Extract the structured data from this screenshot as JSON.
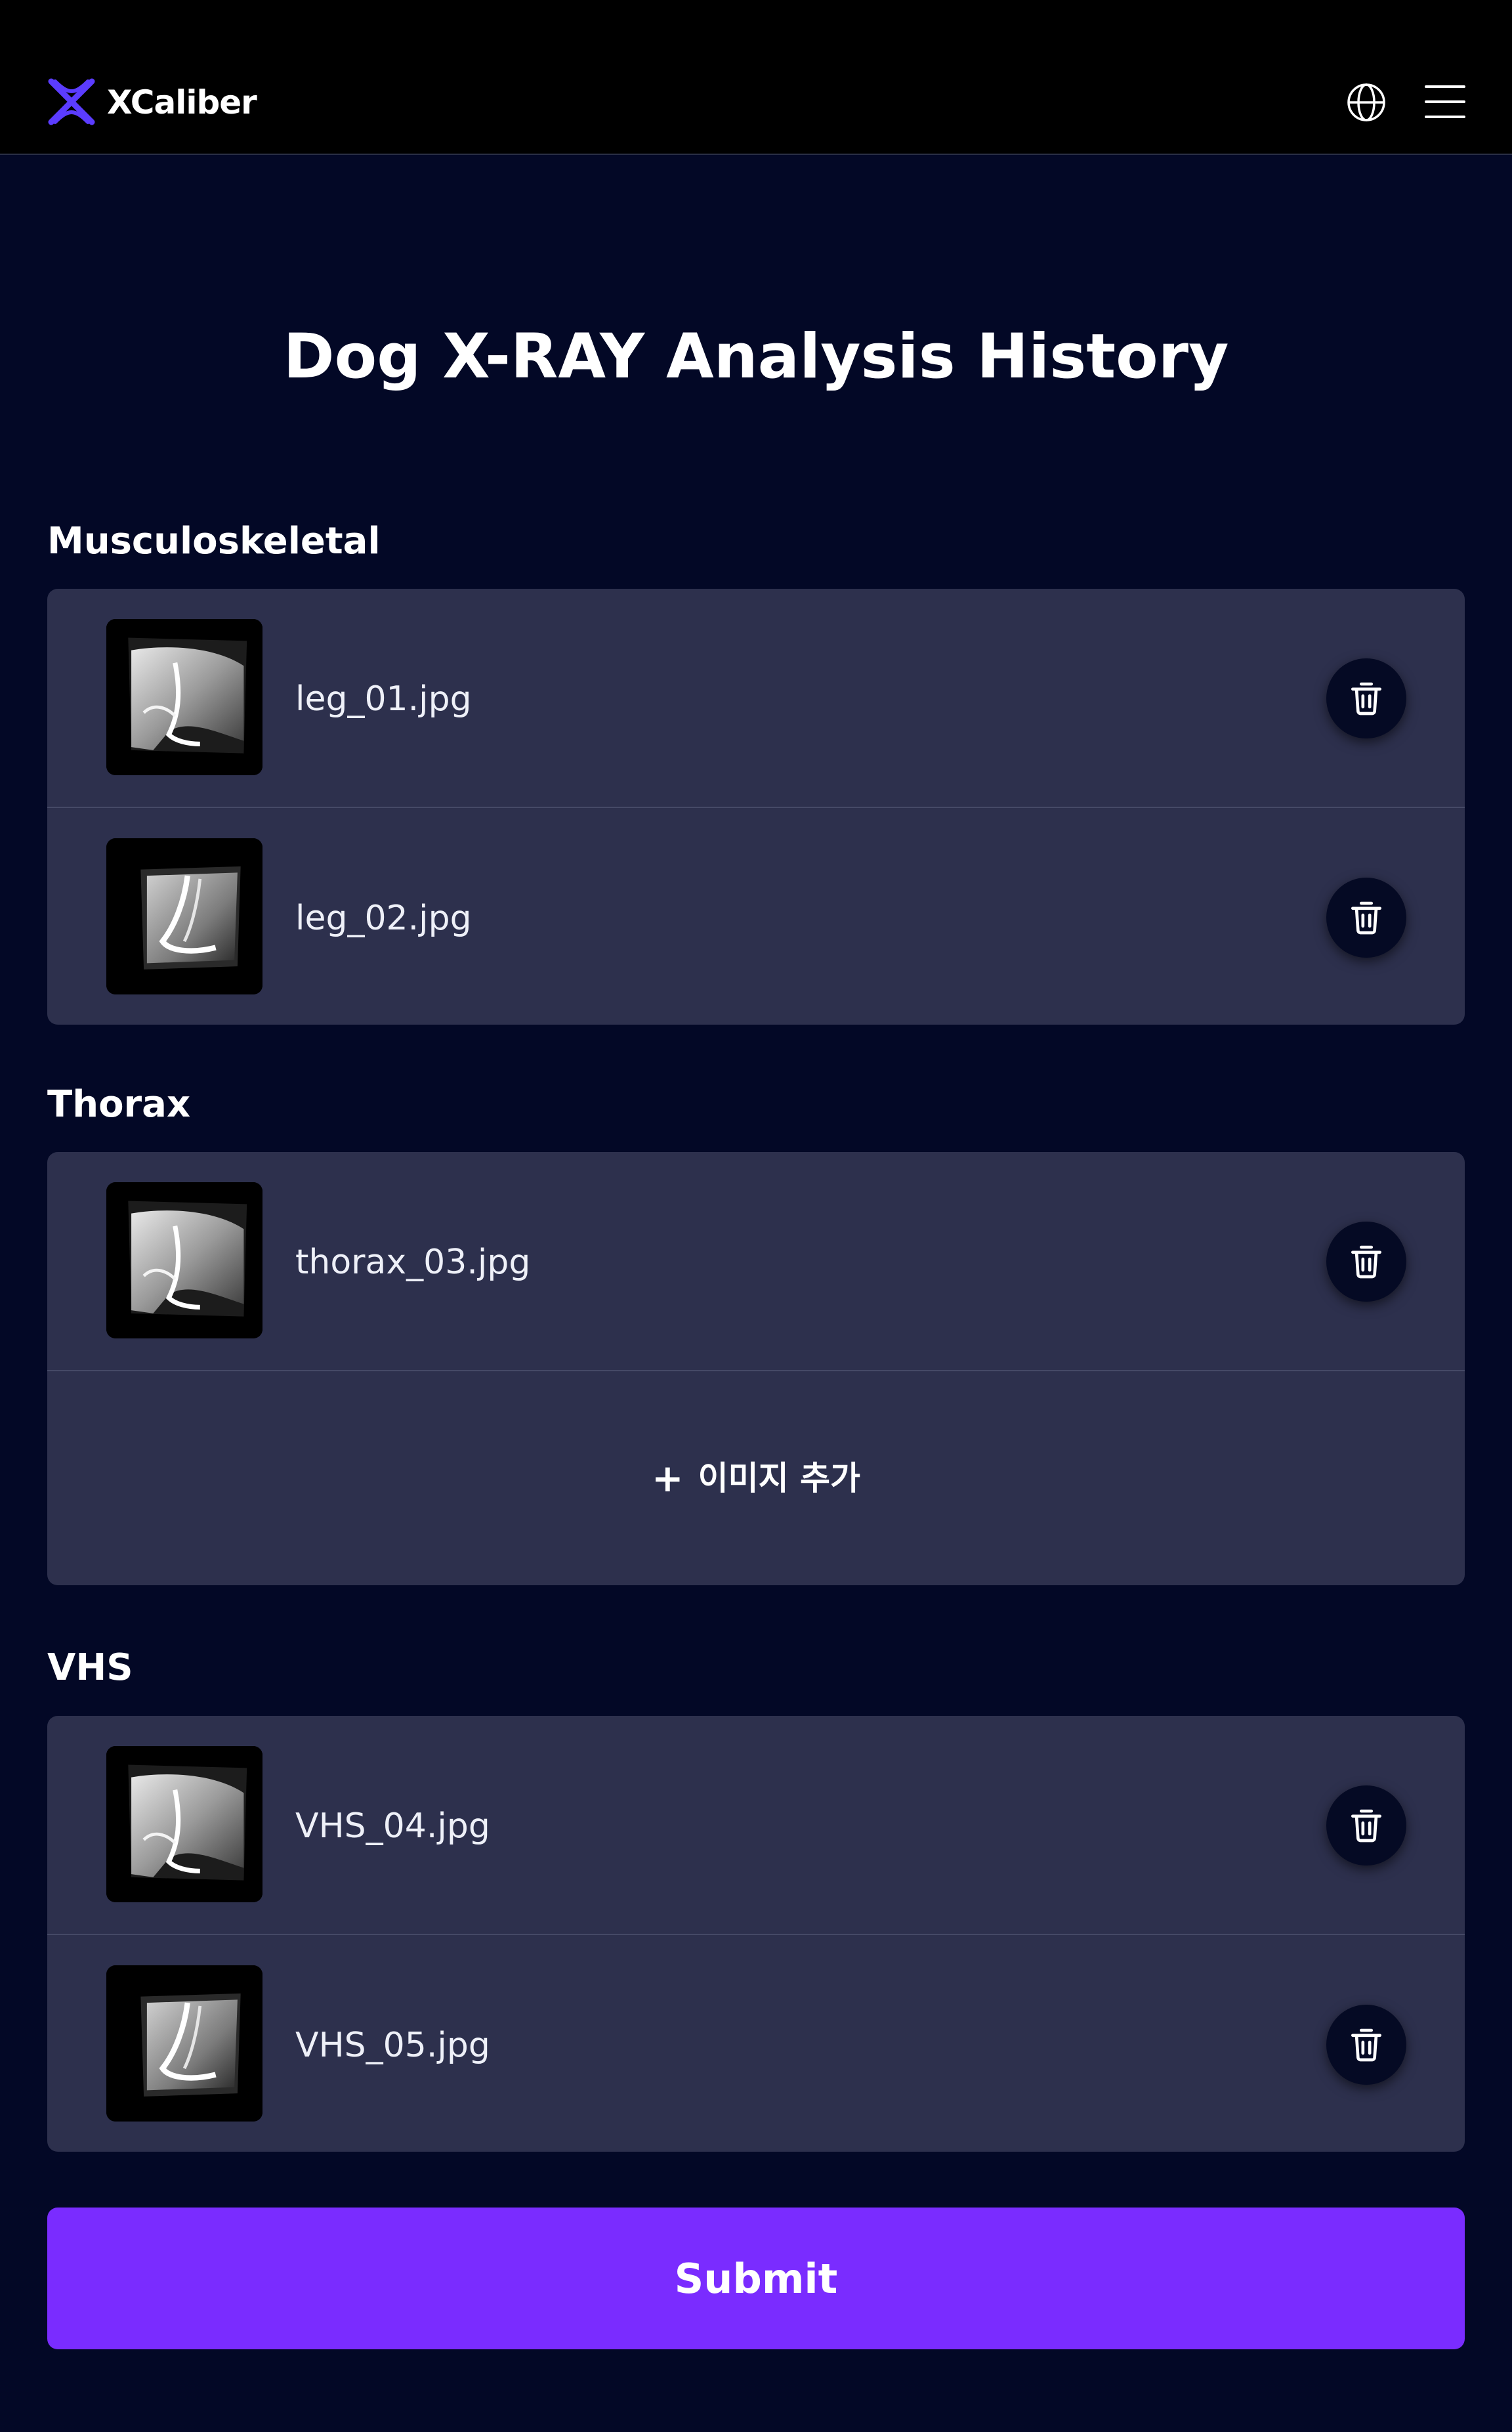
{
  "header": {
    "brand": "XCaliber",
    "logo_icon": "xcaliber-logo-icon",
    "language_icon": "globe-icon",
    "menu_icon": "hamburger-menu-icon"
  },
  "page": {
    "title": "Dog X-RAY Analysis History"
  },
  "sections": [
    {
      "title": "Musculoskeletal",
      "items": [
        {
          "file": "leg_01.jpg"
        },
        {
          "file": "leg_02.jpg"
        }
      ]
    },
    {
      "title": "Thorax",
      "items": [
        {
          "file": "thorax_03.jpg"
        }
      ],
      "add_label": "이미지 추가",
      "add_icon": "plus-icon"
    },
    {
      "title": "VHS",
      "items": [
        {
          "file": "VHS_04.jpg"
        },
        {
          "file": "VHS_05.jpg"
        }
      ]
    }
  ],
  "actions": {
    "submit_label": "Submit",
    "delete_icon": "trash-icon"
  },
  "colors": {
    "background": "#030826",
    "header": "#000000",
    "card": "#2d304d",
    "accent": "#7a2cff",
    "logo": "#5b3cff"
  }
}
